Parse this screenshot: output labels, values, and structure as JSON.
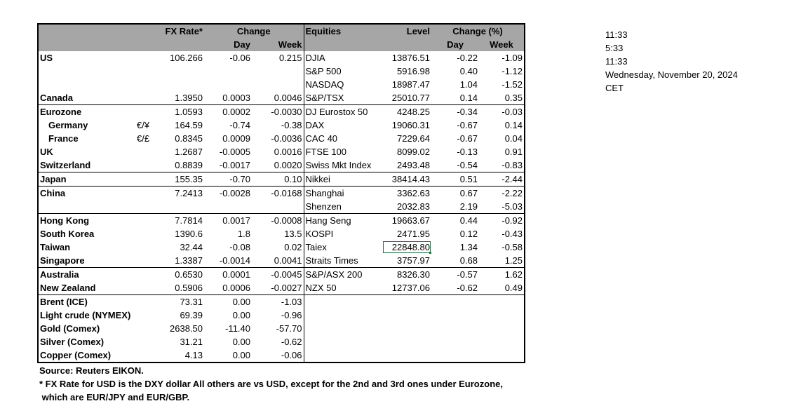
{
  "header": {
    "fx_rate": "FX Rate*",
    "change": "Change",
    "day": "Day",
    "week": "Week",
    "equities": "Equities",
    "level": "Level",
    "change_pct": "Change (%)",
    "eq_day": "Day",
    "eq_week": "Week"
  },
  "rows": [
    {
      "country": "US",
      "bold": true,
      "indent": false,
      "cur": "",
      "fx": "106.266",
      "fx_day": "-0.06",
      "fx_week": "0.215",
      "index": "DJIA",
      "level": "13876.51",
      "eq_day": "-0.22",
      "eq_week": "-1.09",
      "sep": false
    },
    {
      "country": "",
      "bold": true,
      "indent": false,
      "cur": "",
      "fx": "",
      "fx_day": "",
      "fx_week": "",
      "index": "S&P 500",
      "level": "5916.98",
      "eq_day": "0.40",
      "eq_week": "-1.12",
      "sep": false
    },
    {
      "country": "",
      "bold": true,
      "indent": false,
      "cur": "",
      "fx": "",
      "fx_day": "",
      "fx_week": "",
      "index": "NASDAQ",
      "level": "18987.47",
      "eq_day": "1.04",
      "eq_week": "-1.52",
      "sep": false
    },
    {
      "country": "Canada",
      "bold": true,
      "indent": false,
      "cur": "",
      "fx": "1.3950",
      "fx_day": "0.0003",
      "fx_week": "0.0046",
      "index": "S&P/TSX",
      "level": "25010.77",
      "eq_day": "0.14",
      "eq_week": "0.35",
      "sep": false
    },
    {
      "country": "Eurozone",
      "bold": true,
      "indent": false,
      "cur": "",
      "fx": "1.0593",
      "fx_day": "0.0002",
      "fx_week": "-0.0030",
      "index": "DJ Eurostox 50",
      "level": "4248.25",
      "eq_day": "-0.34",
      "eq_week": "-0.03",
      "sep": true
    },
    {
      "country": "Germany",
      "bold": true,
      "indent": true,
      "cur": "€/¥",
      "fx": "164.59",
      "fx_day": "-0.74",
      "fx_week": "-0.38",
      "index": "DAX",
      "level": "19060.31",
      "eq_day": "-0.67",
      "eq_week": "0.14",
      "sep": false
    },
    {
      "country": "France",
      "bold": true,
      "indent": true,
      "cur": "€/£",
      "fx": "0.8345",
      "fx_day": "0.0009",
      "fx_week": "-0.0036",
      "index": "CAC 40",
      "level": "7229.64",
      "eq_day": "-0.67",
      "eq_week": "0.04",
      "sep": false
    },
    {
      "country": "UK",
      "bold": true,
      "indent": false,
      "cur": "",
      "fx": "1.2687",
      "fx_day": "-0.0005",
      "fx_week": "0.0016",
      "index": "FTSE 100",
      "level": "8099.02",
      "eq_day": "-0.13",
      "eq_week": "0.91",
      "sep": false
    },
    {
      "country": "Switzerland",
      "bold": true,
      "indent": false,
      "cur": "",
      "fx": "0.8839",
      "fx_day": "-0.0017",
      "fx_week": "0.0020",
      "index": "Swiss Mkt Index",
      "level": "2493.48",
      "eq_day": "-0.54",
      "eq_week": "-0.83",
      "sep": false
    },
    {
      "country": "Japan",
      "bold": true,
      "indent": false,
      "cur": "",
      "fx": "155.35",
      "fx_day": "-0.70",
      "fx_week": "0.10",
      "index": "Nikkei",
      "level": "38414.43",
      "eq_day": "0.51",
      "eq_week": "-2.44",
      "sep": true
    },
    {
      "country": "China",
      "bold": true,
      "indent": false,
      "cur": "",
      "fx": "7.2413",
      "fx_day": "-0.0028",
      "fx_week": "-0.0168",
      "index": "Shanghai",
      "level": "3362.63",
      "eq_day": "0.67",
      "eq_week": "-2.22",
      "sep": true
    },
    {
      "country": "",
      "bold": true,
      "indent": false,
      "cur": "",
      "fx": "",
      "fx_day": "",
      "fx_week": "",
      "index": "Shenzen",
      "level": "2032.83",
      "eq_day": "2.19",
      "eq_week": "-5.03",
      "sep": false
    },
    {
      "country": "Hong Kong",
      "bold": true,
      "indent": false,
      "cur": "",
      "fx": "7.7814",
      "fx_day": "0.0017",
      "fx_week": "-0.0008",
      "index": "Hang Seng",
      "level": "19663.67",
      "eq_day": "0.44",
      "eq_week": "-0.92",
      "sep": true
    },
    {
      "country": "South Korea",
      "bold": true,
      "indent": false,
      "cur": "",
      "fx": "1390.6",
      "fx_day": "1.8",
      "fx_week": "13.5",
      "index": "KOSPI",
      "level": "2471.95",
      "eq_day": "0.12",
      "eq_week": "-0.43",
      "sep": false
    },
    {
      "country": "Taiwan",
      "bold": true,
      "indent": false,
      "cur": "",
      "fx": "32.44",
      "fx_day": "-0.08",
      "fx_week": "0.02",
      "index": "Taiex",
      "level": "22848.80",
      "eq_day": "1.34",
      "eq_week": "-0.58",
      "sep": false,
      "selected": true
    },
    {
      "country": "Singapore",
      "bold": true,
      "indent": false,
      "cur": "",
      "fx": "1.3387",
      "fx_day": "-0.0014",
      "fx_week": "0.0041",
      "index": "Straits Times",
      "level": "3757.97",
      "eq_day": "0.68",
      "eq_week": "1.25",
      "sep": false
    },
    {
      "country": "Australia",
      "bold": true,
      "indent": false,
      "cur": "",
      "fx": "0.6530",
      "fx_day": "0.0001",
      "fx_week": "-0.0045",
      "index": "S&P/ASX  200",
      "level": "8326.30",
      "eq_day": "-0.57",
      "eq_week": "1.62",
      "sep": true
    },
    {
      "country": "New Zealand",
      "bold": true,
      "indent": false,
      "cur": "",
      "fx": "0.5906",
      "fx_day": "0.0006",
      "fx_week": "-0.0027",
      "index": "NZX 50",
      "level": "12737.06",
      "eq_day": "-0.62",
      "eq_week": "0.49",
      "sep": false
    },
    {
      "country": "Brent (ICE)",
      "bold": true,
      "indent": false,
      "cur": "",
      "fx": "73.31",
      "fx_day": "0.00",
      "fx_week": "-1.03",
      "index": "",
      "level": "",
      "eq_day": "",
      "eq_week": "",
      "sep": true
    },
    {
      "country": "Light crude (NYMEX)",
      "bold": true,
      "indent": false,
      "cur": "",
      "fx": "69.39",
      "fx_day": "0.00",
      "fx_week": "-0.96",
      "index": "",
      "level": "",
      "eq_day": "",
      "eq_week": "",
      "sep": false
    },
    {
      "country": "Gold (Comex)",
      "bold": true,
      "indent": false,
      "cur": "",
      "fx": "2638.50",
      "fx_day": "-11.40",
      "fx_week": "-57.70",
      "index": "",
      "level": "",
      "eq_day": "",
      "eq_week": "",
      "sep": false
    },
    {
      "country": "Silver (Comex)",
      "bold": true,
      "indent": false,
      "cur": "",
      "fx": "31.21",
      "fx_day": "0.00",
      "fx_week": "-0.62",
      "index": "",
      "level": "",
      "eq_day": "",
      "eq_week": "",
      "sep": false
    },
    {
      "country": "Copper (Comex)",
      "bold": true,
      "indent": false,
      "cur": "",
      "fx": "4.13",
      "fx_day": "0.00",
      "fx_week": "-0.06",
      "index": "",
      "level": "",
      "eq_day": "",
      "eq_week": "",
      "sep": false
    }
  ],
  "notes": {
    "source": "Source:  Reuters EIKON.",
    "line1": "* FX Rate for USD is the DXY dollar  All others are vs USD, except for the 2nd and 3rd ones under Eurozone,",
    "line2": " which are EUR/JPY and EUR/GBP."
  },
  "clock": {
    "t1": "11:33",
    "t2": "5:33",
    "t3": "11:33",
    "date": "Wednesday, November 20, 2024",
    "tz": "CET"
  }
}
